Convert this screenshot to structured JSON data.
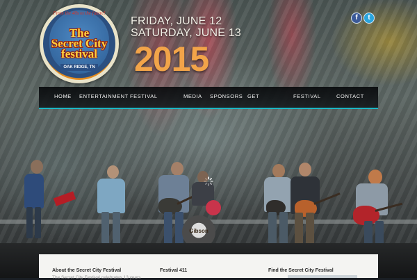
{
  "header": {
    "logo": {
      "tagline": "From the 40s to the future!",
      "title_line1": "The",
      "title_line2": "Secret City",
      "title_line3": "festival",
      "location": "OAK RIDGE, TN"
    },
    "date_line1": "FRIDAY, JUNE 12",
    "date_line2": "SATURDAY, JUNE 13",
    "year": "2015",
    "social": [
      {
        "name": "facebook-icon",
        "glyph": "f"
      },
      {
        "name": "twitter-icon",
        "glyph": "t"
      }
    ]
  },
  "nav": {
    "items": [
      {
        "label": "HOME"
      },
      {
        "label": "ENTERTAINMENT"
      },
      {
        "label": "FESTIVAL"
      },
      {
        "label": "MEDIA"
      },
      {
        "label": "SPONSORS"
      },
      {
        "label": "GET"
      },
      {
        "label": "FESTIVAL"
      },
      {
        "label": "CONTACT"
      }
    ],
    "accent": "#1bb8c5"
  },
  "stage": {
    "drum_label": "Gibson"
  },
  "content": {
    "col1_title": "About the Secret City Festival",
    "col1_text": "The Secret City Festival celebrates 13 years",
    "col2_title": "Festival 411",
    "col3_title": "Find the Secret City Festival"
  },
  "colors": {
    "year": "#f2a449",
    "nav_bg": "#0b0e11",
    "logo_orange": "#e48b1d",
    "logo_blue": "#2c5c93"
  }
}
